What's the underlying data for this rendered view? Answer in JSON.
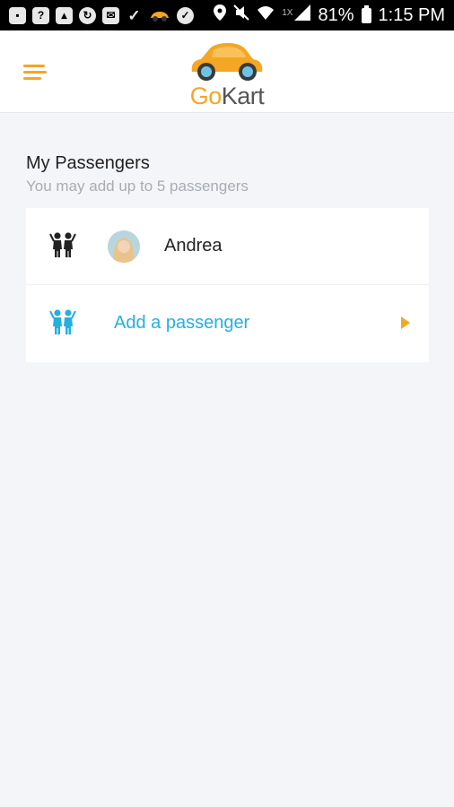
{
  "status_bar": {
    "signal_label": "1X",
    "battery": "81%",
    "time": "1:15 PM"
  },
  "app": {
    "logo_part1": "Go",
    "logo_part2": "Kart"
  },
  "section": {
    "title": "My Passengers",
    "subtitle": "You may add up to 5 passengers"
  },
  "passengers": [
    {
      "name": "Andrea"
    }
  ],
  "add_action": {
    "label": "Add a passenger"
  },
  "colors": {
    "accent": "#f5a623",
    "link": "#25aee0",
    "background": "#f3f5f9"
  }
}
